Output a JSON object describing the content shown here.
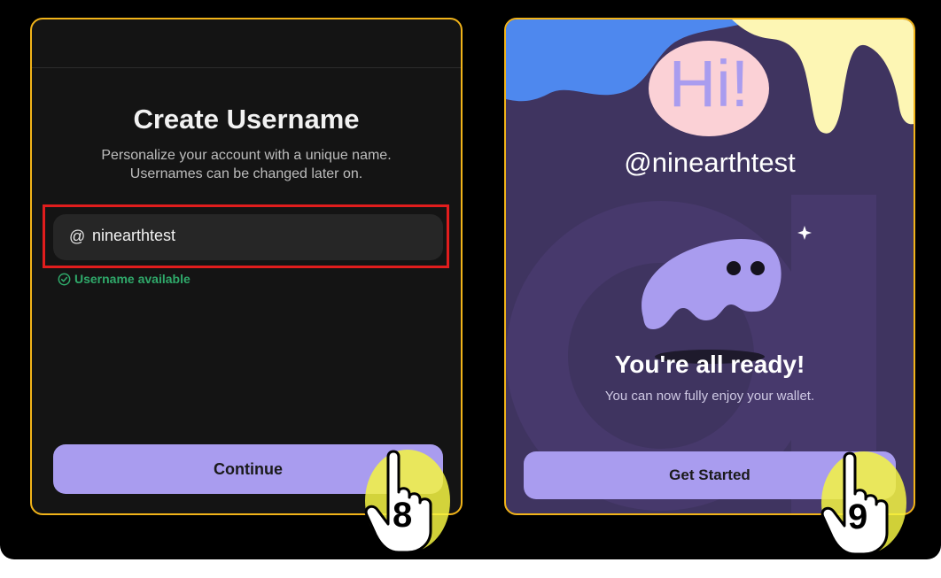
{
  "create_username": {
    "title": "Create Username",
    "subtitle_line1": "Personalize your account with a unique name.",
    "subtitle_line2": "Usernames can be changed later on.",
    "input_prefix": "@",
    "input_value": "ninearthtest",
    "availability": "Username available",
    "continue_label": "Continue",
    "step_number": "8"
  },
  "ready": {
    "greeting": "Hi!",
    "username": "@ninearthtest",
    "title": "You're all ready!",
    "subtitle": "You can now fully enjoy your wallet.",
    "button_label": "Get Started",
    "step_number": "9"
  },
  "icons": {
    "available": "check-circle-icon",
    "cursor": "hand-pointer-icon",
    "sparkle": "sparkle-icon"
  },
  "colors": {
    "frame_border": "#f1b319",
    "button_bg": "#a99cef",
    "success": "#2fa96a",
    "highlight": "#e11d1d",
    "panel2_bg": "#3f3460",
    "cursor_glow": "#f5f542"
  }
}
